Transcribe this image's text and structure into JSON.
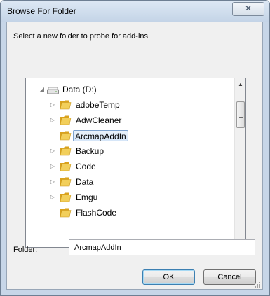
{
  "window": {
    "title": "Browse For Folder",
    "close_glyph": "✕"
  },
  "instruction": "Select a new folder to probe for add-ins.",
  "tree": {
    "root": {
      "label": "Data (D:)",
      "expanded": true,
      "icon": "drive-icon"
    },
    "items": [
      {
        "label": "adobeTemp",
        "has_children": true,
        "selected": false
      },
      {
        "label": "AdwCleaner",
        "has_children": true,
        "selected": false
      },
      {
        "label": "ArcmapAddIn",
        "has_children": false,
        "selected": true
      },
      {
        "label": "Backup",
        "has_children": true,
        "selected": false
      },
      {
        "label": "Code",
        "has_children": true,
        "selected": false
      },
      {
        "label": "Data",
        "has_children": true,
        "selected": false
      },
      {
        "label": "Emgu",
        "has_children": true,
        "selected": false
      },
      {
        "label": "FlashCode",
        "has_children": false,
        "selected": false
      }
    ],
    "scrollbar": {
      "up_glyph": "▲",
      "down_glyph": "▼"
    }
  },
  "folder": {
    "label": "Folder:",
    "value": "ArcmapAddIn"
  },
  "buttons": {
    "ok": "OK",
    "cancel": "Cancel"
  },
  "colors": {
    "selection_border": "#7da2ce",
    "folder_yellow": "#e8b73a",
    "window_frame": "#c7d6e8"
  }
}
